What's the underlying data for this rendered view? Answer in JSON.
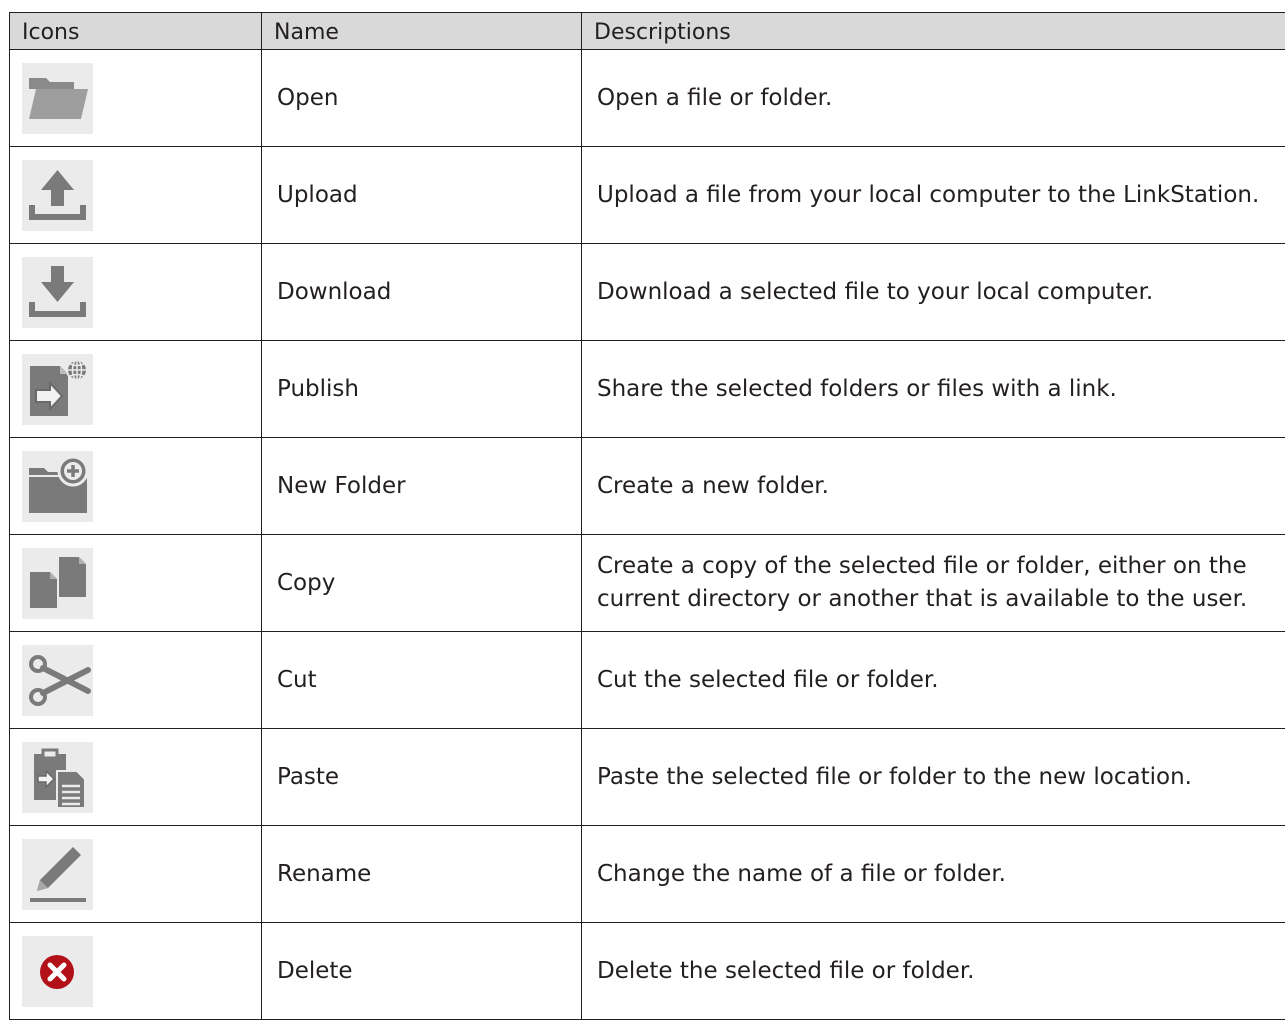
{
  "table": {
    "headers": {
      "icons": "Icons",
      "name": "Name",
      "descriptions": "Descriptions"
    },
    "rows": [
      {
        "icon": "folder-open-icon",
        "name": "Open",
        "description": "Open a file or folder."
      },
      {
        "icon": "upload-icon",
        "name": "Upload",
        "description": "Upload a file from your local computer to the LinkStation."
      },
      {
        "icon": "download-icon",
        "name": "Download",
        "description": "Download a selected file to your local computer."
      },
      {
        "icon": "publish-icon",
        "name": "Publish",
        "description": "Share the selected folders or files with a link."
      },
      {
        "icon": "new-folder-icon",
        "name": "New Folder",
        "description": "Create a new folder."
      },
      {
        "icon": "copy-icon",
        "name": "Copy",
        "description": "Create a copy of the selected file or folder, either on the current directory or another that is available to the user."
      },
      {
        "icon": "scissors-icon",
        "name": "Cut",
        "description": "Cut the selected file or folder."
      },
      {
        "icon": "paste-icon",
        "name": "Paste",
        "description": "Paste the selected file or folder to the new location."
      },
      {
        "icon": "pencil-icon",
        "name": "Rename",
        "description": "Change the name of a file or folder."
      },
      {
        "icon": "delete-icon",
        "name": "Delete",
        "description": "Delete the selected file or folder."
      }
    ]
  },
  "colors": {
    "icon_gray": "#7a7a7a",
    "icon_background": "#ebebeb",
    "header_background": "#d9d9d9",
    "delete_red": "#b3111a"
  }
}
